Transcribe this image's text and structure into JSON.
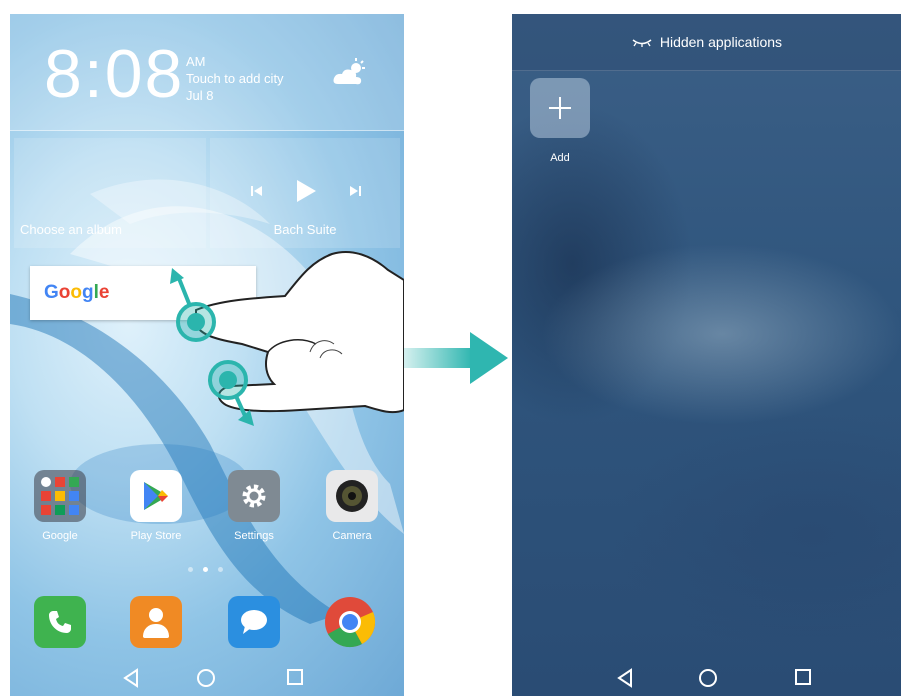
{
  "left_screen": {
    "clock": {
      "time": "8:08",
      "ampm": "AM",
      "city": "Touch to add city",
      "date": "Jul 8"
    },
    "album_widget": {
      "label": "Choose an album"
    },
    "music_widget": {
      "title": "Bach Suite"
    },
    "search": {
      "logo_text": "Google"
    },
    "apps": [
      {
        "label": "Google",
        "icon": "google-folder-icon"
      },
      {
        "label": "Play Store",
        "icon": "play-store-icon"
      },
      {
        "label": "Settings",
        "icon": "settings-gear-icon"
      },
      {
        "label": "Camera",
        "icon": "camera-icon"
      }
    ],
    "dock": [
      {
        "icon": "phone-icon",
        "color": "#3fb34f"
      },
      {
        "icon": "contacts-icon",
        "color": "#f08a24"
      },
      {
        "icon": "messages-icon",
        "color": "#2b8fe0"
      },
      {
        "icon": "chrome-icon",
        "color": "#e04a3a"
      }
    ],
    "page_indicator": {
      "pages": 3,
      "current": 2
    }
  },
  "right_screen": {
    "header": {
      "title": "Hidden applications",
      "icon": "closed-eye-icon"
    },
    "add_button": {
      "label": "Add",
      "icon": "plus-icon"
    }
  },
  "colors": {
    "accent_teal": "#2bb5ad",
    "arrow_teal": "#2fb6b0"
  }
}
